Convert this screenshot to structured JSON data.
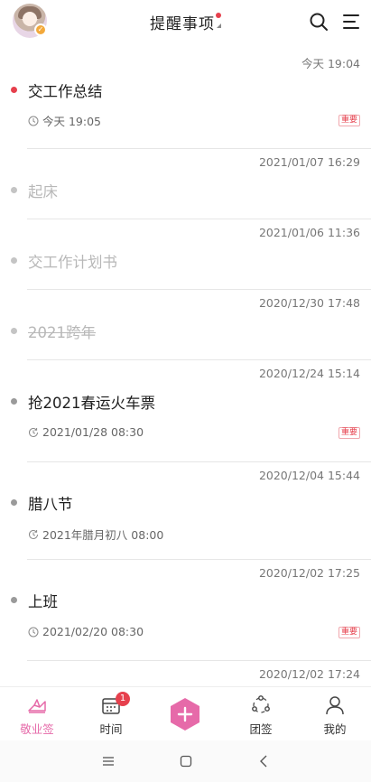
{
  "header": {
    "title": "提醒事项"
  },
  "items": [
    {
      "stamp": "今天 19:04",
      "title": "交工作总结",
      "state": "active",
      "dot": "red",
      "meta_icon": "clock-icon",
      "meta": "今天 19:05",
      "tag": "重要"
    },
    {
      "stamp": "2021/01/07 16:29",
      "title": "起床",
      "state": "done-plain"
    },
    {
      "stamp": "2021/01/06 11:36",
      "title": "交工作计划书",
      "state": "done-plain"
    },
    {
      "stamp": "2020/12/30 17:48",
      "title": "2021跨年",
      "state": "done-strike"
    },
    {
      "stamp": "2020/12/24 15:14",
      "title": "抢2021春运火车票",
      "state": "active",
      "meta_icon": "repeat-clock-icon",
      "meta": "2021/01/28 08:30",
      "tag": "重要"
    },
    {
      "stamp": "2020/12/04 15:44",
      "title": "腊八节",
      "state": "active",
      "meta_icon": "repeat-clock-icon",
      "meta": "2021年腊月初八 08:00"
    },
    {
      "stamp": "2020/12/02 17:25",
      "title": "上班",
      "state": "active",
      "meta_icon": "clock-icon",
      "meta": "2021/02/20 08:30",
      "tag": "重要"
    },
    {
      "stamp": "2020/12/02 17:24"
    }
  ],
  "tabbar": {
    "tabs": [
      {
        "label": "敬业签",
        "icon": "notebook-icon",
        "active": true
      },
      {
        "label": "时间",
        "icon": "calendar-icon",
        "badge": "1"
      },
      {
        "label": "",
        "icon": "add-icon"
      },
      {
        "label": "团签",
        "icon": "team-icon"
      },
      {
        "label": "我的",
        "icon": "profile-icon"
      }
    ]
  },
  "colors": {
    "accent": "#e66aa9",
    "alert": "#e6404d",
    "avatar_badge": "#f3a93b"
  }
}
